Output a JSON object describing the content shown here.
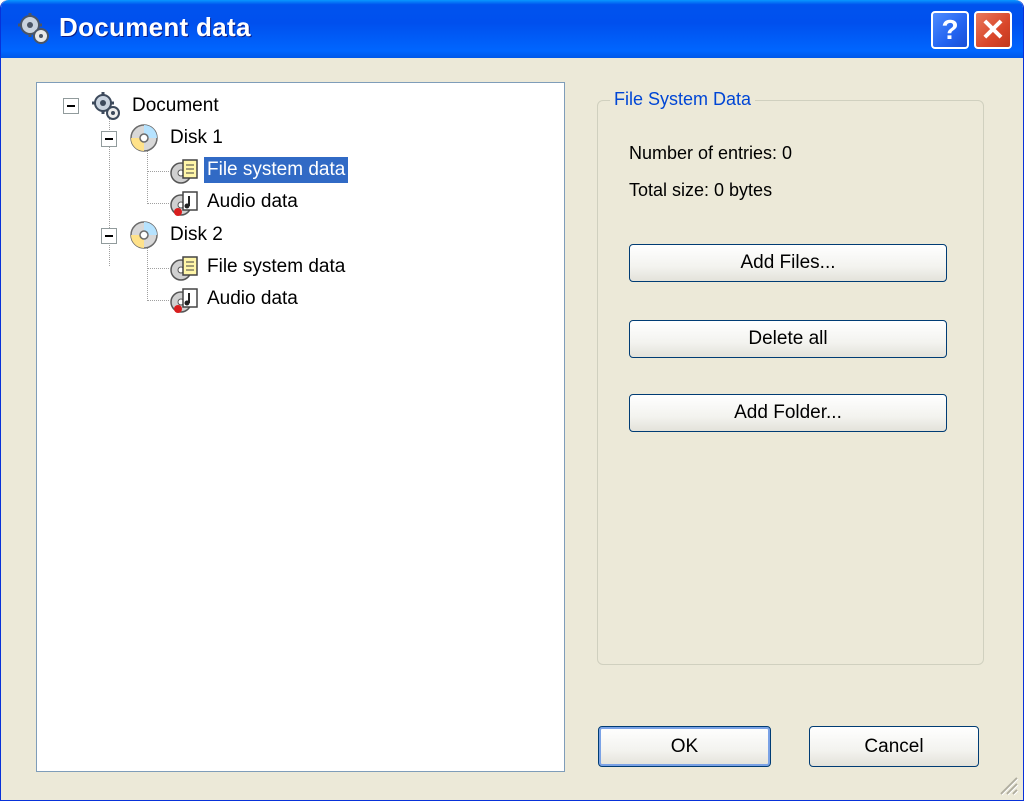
{
  "window": {
    "title": "Document data",
    "help_label": "?",
    "close_label": "✕"
  },
  "tree": {
    "root": {
      "label": "Document",
      "icon": "document-gear-icon"
    },
    "disks": [
      {
        "label": "Disk 1",
        "icon": "cd-disc-icon",
        "children": [
          {
            "label": "File system data",
            "icon": "file-system-data-icon",
            "selected": true
          },
          {
            "label": "Audio data",
            "icon": "audio-data-icon",
            "selected": false
          }
        ]
      },
      {
        "label": "Disk 2",
        "icon": "cd-disc-icon",
        "children": [
          {
            "label": "File system data",
            "icon": "file-system-data-icon",
            "selected": false
          },
          {
            "label": "Audio data",
            "icon": "audio-data-icon",
            "selected": false
          }
        ]
      }
    ]
  },
  "panel": {
    "group_title": "File System Data",
    "entries_text": "Number of entries: 0",
    "size_text": "Total size: 0 bytes",
    "add_files_label": "Add Files...",
    "delete_all_label": "Delete all",
    "add_folder_label": "Add Folder..."
  },
  "footer": {
    "ok_label": "OK",
    "cancel_label": "Cancel"
  },
  "colors": {
    "title_blue": "#0053ee",
    "selection": "#316ac5",
    "group_title": "#0046d5",
    "dialog_bg": "#ece9d8"
  }
}
